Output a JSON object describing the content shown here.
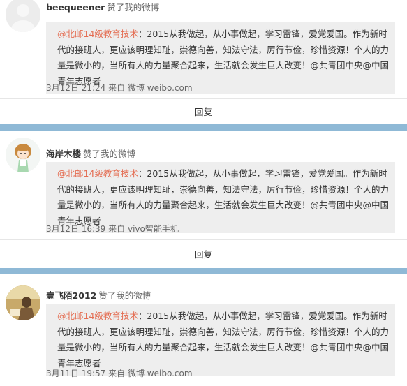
{
  "posts": [
    {
      "username": "beequeener",
      "action": "赞了我的微博",
      "quote": {
        "mention": "@北邮14级教育技术",
        "text": "：2015从我做起，从小事做起，学习雷锋，爱党爱国。作为新时代的接班人，更应该明理知耻，崇德向善，知法守法，厉行节俭，珍惜资源！个人的力量是微小的，当所有人的力量聚合起来，生活就会发生巨大改变！@共青团中央@中国青年志愿者"
      },
      "time": "3月12日 21:24",
      "source_prefix": "来自",
      "source": "微博 weibo.com",
      "reply_label": "回复"
    },
    {
      "username": "海岸木楼",
      "action": "赞了我的微博",
      "quote": {
        "mention": "@北邮14级教育技术",
        "text": "：2015从我做起，从小事做起，学习雷锋，爱党爱国。作为新时代的接班人，更应该明理知耻，崇德向善，知法守法，厉行节俭，珍惜资源！个人的力量是微小的，当所有人的力量聚合起来，生活就会发生巨大改变！@共青团中央@中国青年志愿者"
      },
      "time": "3月12日 16:39",
      "source_prefix": "来自",
      "source": "vivo智能手机",
      "reply_label": "回复"
    },
    {
      "username": "壹飞陌2012",
      "action": "赞了我的微博",
      "quote": {
        "mention": "@北邮14级教育技术",
        "text": "：2015从我做起，从小事做起，学习雷锋，爱党爱国。作为新时代的接班人，更应该明理知耻，崇德向善，知法守法，厉行节俭，珍惜资源！个人的力量是微小的，当所有人的力量聚合起来，生活就会发生巨大改变！@共青团中央@中国青年志愿者"
      },
      "time": "3月11日 19:57",
      "source_prefix": "来自",
      "source": "微博 weibo.com",
      "reply_label": ""
    }
  ],
  "colors": {
    "separator": "#8fb9d6",
    "quote_bg": "#eeeeee",
    "mention": "#e46d52"
  }
}
